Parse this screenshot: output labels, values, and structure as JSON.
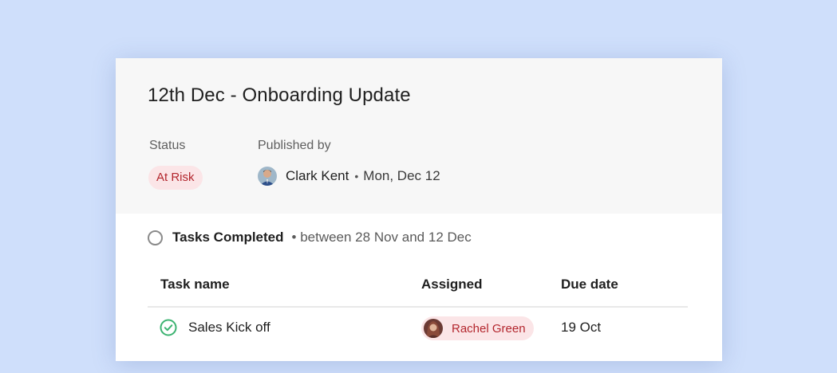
{
  "update": {
    "title": "12th Dec - Onboarding Update",
    "status_label": "Status",
    "status_value": "At Risk",
    "published_label": "Published by",
    "publisher_name": "Clark Kent",
    "separator": "•",
    "publish_date": "Mon, Dec 12"
  },
  "section": {
    "title": "Tasks Completed",
    "subtitle": "• between 28 Nov and 12 Dec",
    "icon": "circle-outline-icon"
  },
  "table": {
    "columns": [
      "Task name",
      "Assigned",
      "Due date"
    ],
    "rows": [
      {
        "task": "Sales Kick off",
        "assignee": "Rachel Green",
        "due": "19 Oct",
        "status_icon": "check-circle-icon"
      }
    ]
  },
  "colors": {
    "background": "#cfdffb",
    "risk_badge_bg": "#fbe5e7",
    "risk_text": "#b3262d",
    "complete_green": "#3cb371"
  }
}
